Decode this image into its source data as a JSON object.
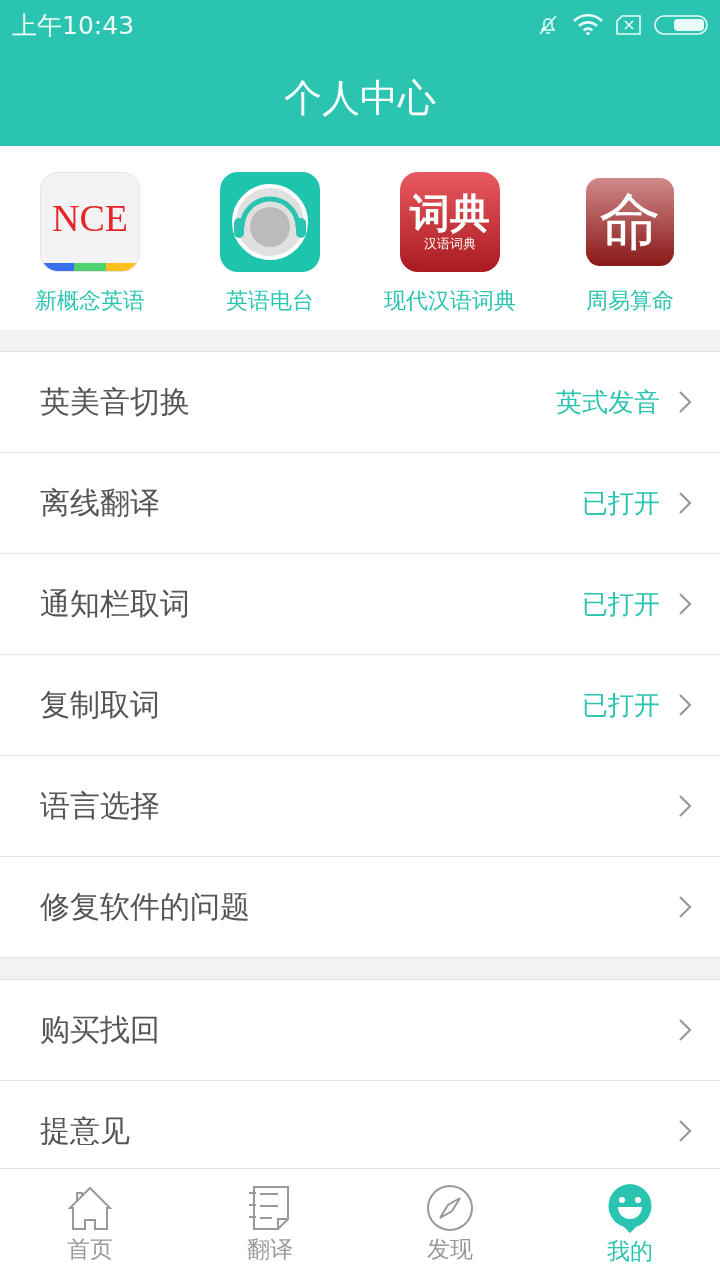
{
  "status_bar": {
    "time": "上午10:43"
  },
  "header": {
    "title": "个人中心"
  },
  "apps": [
    {
      "kind": "nce",
      "label": "新概念英语",
      "icon_text": "NCE"
    },
    {
      "kind": "radio",
      "label": "英语电台"
    },
    {
      "kind": "dict",
      "label": "现代汉语词典",
      "icon_text": "词典",
      "icon_subtext": "汉语词典"
    },
    {
      "kind": "fortune",
      "label": "周易算命",
      "icon_text": "命"
    }
  ],
  "settings_groups": [
    {
      "rows": [
        {
          "label": "英美音切换",
          "value": "英式发音"
        },
        {
          "label": "离线翻译",
          "value": "已打开"
        },
        {
          "label": "通知栏取词",
          "value": "已打开"
        },
        {
          "label": "复制取词",
          "value": "已打开"
        },
        {
          "label": "语言选择"
        },
        {
          "label": "修复软件的问题"
        }
      ]
    },
    {
      "rows": [
        {
          "label": "购买找回"
        },
        {
          "label": "提意见"
        }
      ]
    }
  ],
  "tab_bar": [
    {
      "kind": "home",
      "label": "首页",
      "selected": false
    },
    {
      "kind": "translate",
      "label": "翻译",
      "selected": false
    },
    {
      "kind": "discover",
      "label": "发现",
      "selected": false
    },
    {
      "kind": "mine",
      "label": "我的",
      "selected": true
    }
  ]
}
